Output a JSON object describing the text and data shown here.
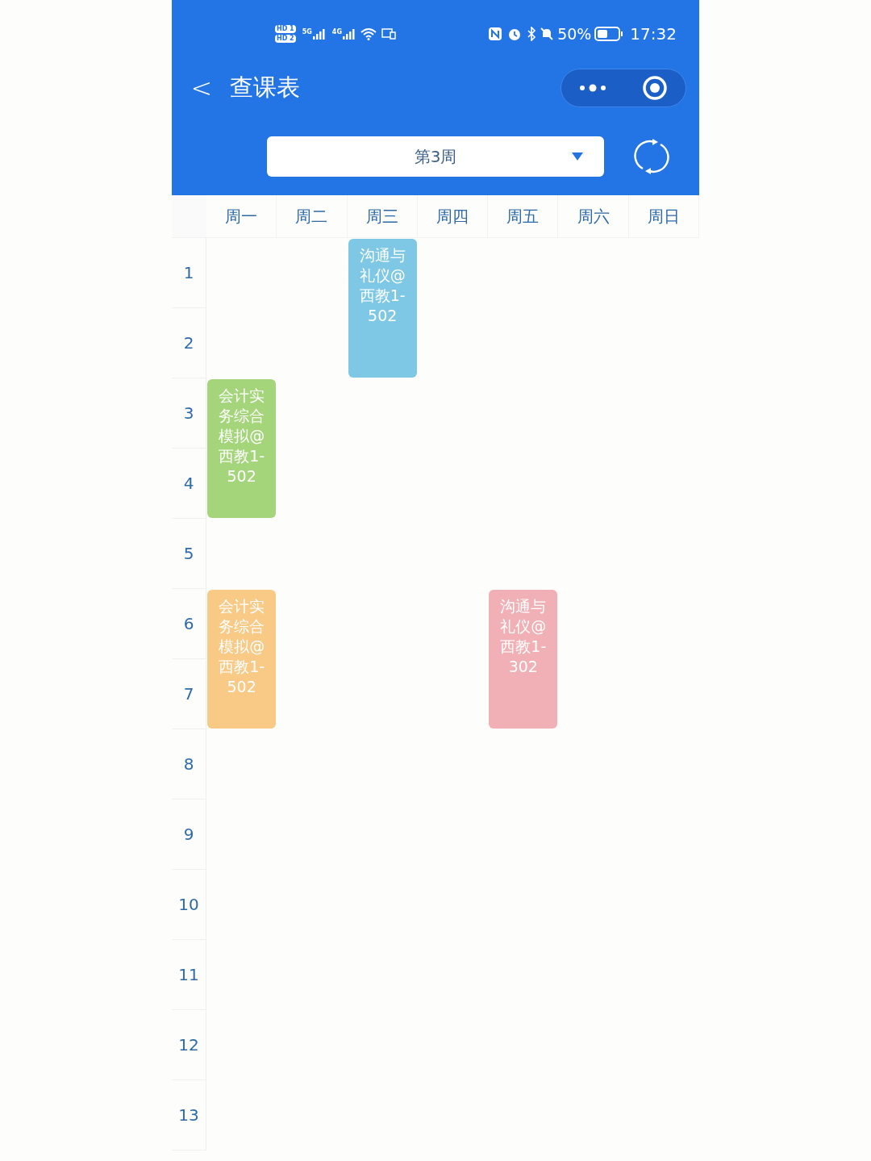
{
  "status_bar": {
    "sim_labels": [
      "HD 1",
      "HD 2"
    ],
    "networks": [
      "5G",
      "4G"
    ],
    "battery": "50%",
    "time": "17:32"
  },
  "nav": {
    "back": "<",
    "title": "查课表"
  },
  "week_selector": {
    "value": "第3周"
  },
  "days": [
    {
      "label": "周一"
    },
    {
      "label": "周二"
    },
    {
      "label": "周三"
    },
    {
      "label": "周四"
    },
    {
      "label": "周五"
    },
    {
      "label": "周六"
    },
    {
      "label": "周日"
    }
  ],
  "rows": [
    {
      "period": "1",
      "cells": [
        {
          "kind": "empty"
        },
        {
          "kind": "empty"
        },
        {
          "kind": "course",
          "text": "沟通与礼仪@西教1-502",
          "color": "#7ec8e6"
        },
        {
          "kind": "empty"
        },
        {
          "kind": "empty"
        },
        {
          "kind": "empty"
        },
        {
          "kind": "empty"
        }
      ]
    },
    {
      "period": "2",
      "cells": [
        {
          "kind": "empty"
        },
        {
          "kind": "empty"
        },
        {
          "kind": "continued"
        },
        {
          "kind": "empty"
        },
        {
          "kind": "empty"
        },
        {
          "kind": "empty"
        },
        {
          "kind": "empty"
        }
      ]
    },
    {
      "period": "3",
      "cells": [
        {
          "kind": "course",
          "text": "会计实务综合模拟@西教1-502",
          "color": "#a4d57a"
        },
        {
          "kind": "empty"
        },
        {
          "kind": "empty"
        },
        {
          "kind": "empty"
        },
        {
          "kind": "empty"
        },
        {
          "kind": "empty"
        },
        {
          "kind": "empty"
        }
      ]
    },
    {
      "period": "4",
      "cells": [
        {
          "kind": "continued"
        },
        {
          "kind": "empty"
        },
        {
          "kind": "empty"
        },
        {
          "kind": "empty"
        },
        {
          "kind": "empty"
        },
        {
          "kind": "empty"
        },
        {
          "kind": "empty"
        }
      ]
    },
    {
      "period": "5",
      "cells": [
        {
          "kind": "empty"
        },
        {
          "kind": "empty"
        },
        {
          "kind": "empty"
        },
        {
          "kind": "empty"
        },
        {
          "kind": "empty"
        },
        {
          "kind": "empty"
        },
        {
          "kind": "empty"
        }
      ]
    },
    {
      "period": "6",
      "cells": [
        {
          "kind": "course",
          "text": "会计实务综合模拟@西教1-502",
          "color": "#f8ca86"
        },
        {
          "kind": "empty"
        },
        {
          "kind": "empty"
        },
        {
          "kind": "empty"
        },
        {
          "kind": "course",
          "text": "沟通与礼仪@西教1-302",
          "color": "#f0b0b5"
        },
        {
          "kind": "empty"
        },
        {
          "kind": "empty"
        }
      ]
    },
    {
      "period": "7",
      "cells": [
        {
          "kind": "continued"
        },
        {
          "kind": "empty"
        },
        {
          "kind": "empty"
        },
        {
          "kind": "empty"
        },
        {
          "kind": "continued"
        },
        {
          "kind": "empty"
        },
        {
          "kind": "empty"
        }
      ]
    },
    {
      "period": "8",
      "cells": [
        {
          "kind": "empty"
        },
        {
          "kind": "empty"
        },
        {
          "kind": "empty"
        },
        {
          "kind": "empty"
        },
        {
          "kind": "empty"
        },
        {
          "kind": "empty"
        },
        {
          "kind": "empty"
        }
      ]
    },
    {
      "period": "9",
      "cells": [
        {
          "kind": "empty"
        },
        {
          "kind": "empty"
        },
        {
          "kind": "empty"
        },
        {
          "kind": "empty"
        },
        {
          "kind": "empty"
        },
        {
          "kind": "empty"
        },
        {
          "kind": "empty"
        }
      ]
    },
    {
      "period": "10",
      "cells": [
        {
          "kind": "empty"
        },
        {
          "kind": "empty"
        },
        {
          "kind": "empty"
        },
        {
          "kind": "empty"
        },
        {
          "kind": "empty"
        },
        {
          "kind": "empty"
        },
        {
          "kind": "empty"
        }
      ]
    },
    {
      "period": "11",
      "cells": [
        {
          "kind": "empty"
        },
        {
          "kind": "empty"
        },
        {
          "kind": "empty"
        },
        {
          "kind": "empty"
        },
        {
          "kind": "empty"
        },
        {
          "kind": "empty"
        },
        {
          "kind": "empty"
        }
      ]
    },
    {
      "period": "12",
      "cells": [
        {
          "kind": "empty"
        },
        {
          "kind": "empty"
        },
        {
          "kind": "empty"
        },
        {
          "kind": "empty"
        },
        {
          "kind": "empty"
        },
        {
          "kind": "empty"
        },
        {
          "kind": "empty"
        }
      ]
    },
    {
      "period": "13",
      "cells": [
        {
          "kind": "empty"
        },
        {
          "kind": "empty"
        },
        {
          "kind": "empty"
        },
        {
          "kind": "empty"
        },
        {
          "kind": "empty"
        },
        {
          "kind": "empty"
        },
        {
          "kind": "empty"
        }
      ]
    }
  ]
}
